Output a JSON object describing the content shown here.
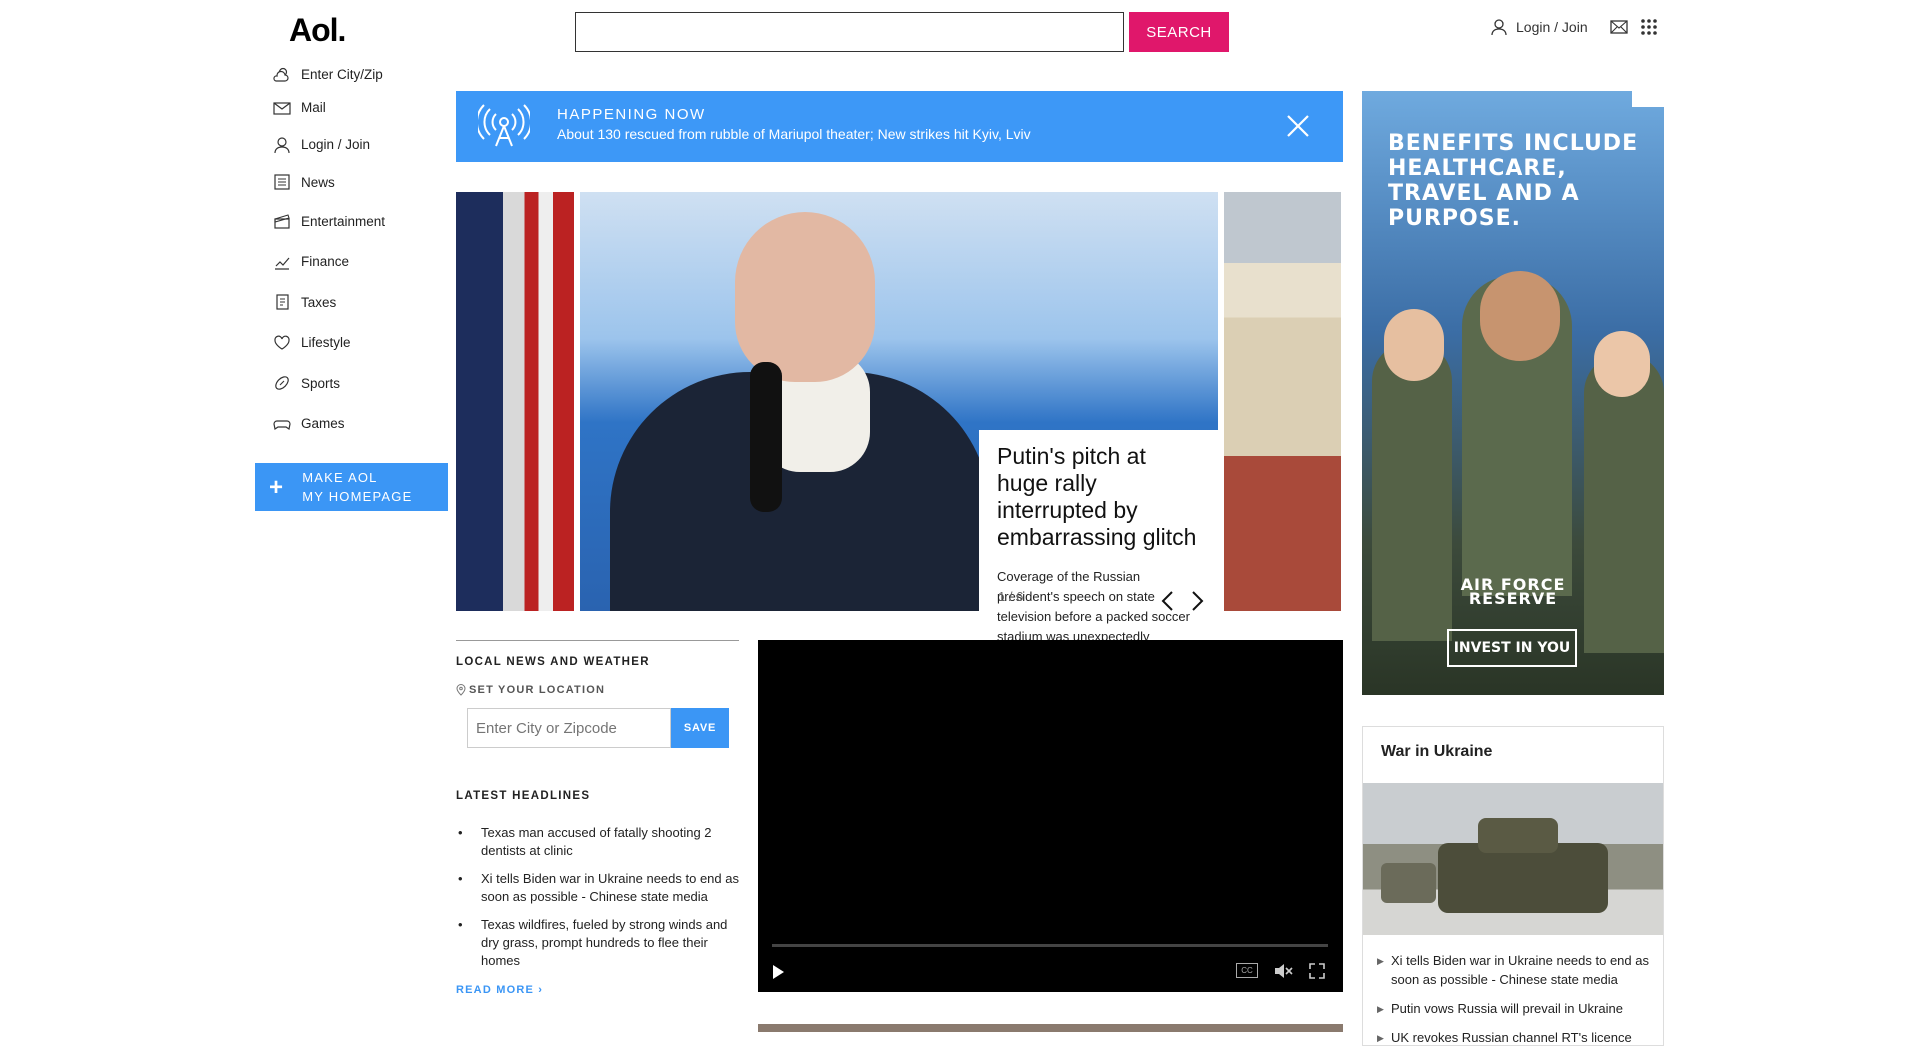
{
  "header": {
    "logo": "Aol.",
    "search_placeholder": "",
    "search_button": "SEARCH",
    "login": "Login / Join"
  },
  "sidebar": {
    "items": [
      {
        "label": "Enter City/Zip",
        "icon": "weather-icon"
      },
      {
        "label": "Mail",
        "icon": "mail-icon"
      },
      {
        "label": "Login / Join",
        "icon": "user-icon"
      },
      {
        "label": "News",
        "icon": "news-icon"
      },
      {
        "label": "Entertainment",
        "icon": "clapperboard-icon"
      },
      {
        "label": "Finance",
        "icon": "chart-icon"
      },
      {
        "label": "Taxes",
        "icon": "taxes-icon"
      },
      {
        "label": "Lifestyle",
        "icon": "heart-icon"
      },
      {
        "label": "Sports",
        "icon": "football-icon"
      },
      {
        "label": "Games",
        "icon": "gamepad-icon"
      }
    ],
    "make_home_line1": "MAKE AOL",
    "make_home_line2": "MY HOMEPAGE"
  },
  "banner": {
    "title": "HAPPENING NOW",
    "text": "About 130 rescued from rubble of Mariupol theater; New strikes hit Kyiv, Lviv"
  },
  "carousel": {
    "title": "Putin's pitch at huge rally interrupted by embarrassing glitch",
    "description": "Coverage of the Russian president's speech on state television before a packed soccer stadium was unexpectedly interrupted by what the Kremlin",
    "counter": "1 / 6"
  },
  "local": {
    "title": "LOCAL NEWS AND WEATHER",
    "set_location": "SET YOUR LOCATION",
    "zip_placeholder": "Enter City or Zipcode",
    "save": "SAVE",
    "latest_title": "LATEST HEADLINES",
    "headlines": [
      "Texas man accused of fatally shooting 2 dentists at clinic",
      "Xi tells Biden war in Ukraine needs to end as soon as possible - Chinese state media",
      "Texas wildfires, fueled by strong winds and dry grass, prompt hundreds to flee their homes"
    ],
    "read_more": "READ MORE ›"
  },
  "video": {
    "cc": "CC"
  },
  "ad": {
    "headline": "BENEFITS INCLUDE HEALTHCARE, TRAVEL AND A PURPOSE.",
    "brand_line1": "AIR FORCE",
    "brand_line2": "RESERVE",
    "cta": "INVEST IN YOU"
  },
  "ukraine": {
    "title": "War in Ukraine",
    "items": [
      "Xi tells Biden war in Ukraine needs to end as soon as possible - Chinese state media",
      "Putin vows Russia will prevail in Ukraine",
      "UK revokes Russian channel RT's licence"
    ]
  },
  "colors": {
    "accent_pink": "#e0176b",
    "accent_blue": "#3b96f5"
  }
}
